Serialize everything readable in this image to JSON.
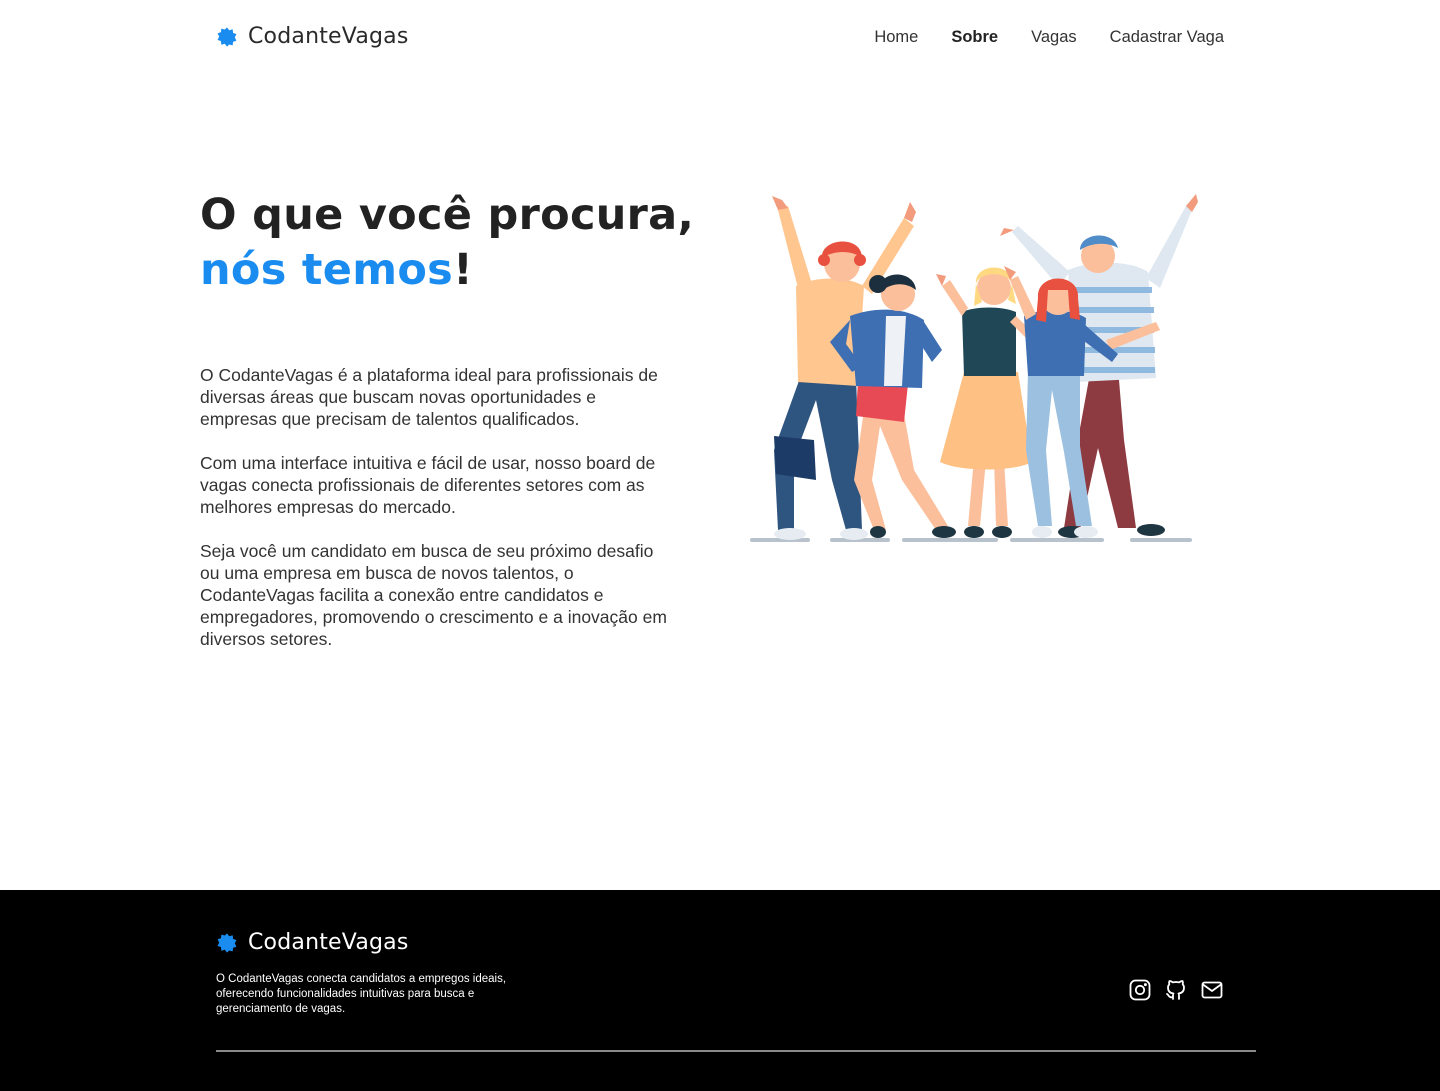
{
  "brand": {
    "name": "CodanteVagas",
    "icon": "star-badge-icon",
    "accent_color": "#1a8cf0"
  },
  "nav": {
    "items": [
      {
        "label": "Home",
        "active": false
      },
      {
        "label": "Sobre",
        "active": true
      },
      {
        "label": "Vagas",
        "active": false
      },
      {
        "label": "Cadastrar Vaga",
        "active": false
      }
    ]
  },
  "hero": {
    "title_line1": "O que você procura,",
    "title_accent": "nós temos",
    "title_end": "!",
    "paragraphs": [
      "O CodanteVagas é a plataforma ideal para profissionais de diversas áreas que buscam novas oportunidades e empresas que precisam de talentos qualificados.",
      "Com uma interface intuitiva e fácil de usar, nosso board de vagas conecta profissionais de diferentes setores com as melhores empresas do mercado.",
      "Seja você um candidato em busca de seu próximo desafio ou uma empresa em busca de novos talentos, o CodanteVagas facilita a conexão entre candidatos e empregadores, promovendo o crescimento e a inovação em diversos setores."
    ],
    "illustration": "group-of-people-celebrating-illustration"
  },
  "footer": {
    "brand_name": "CodanteVagas",
    "description": "O CodanteVagas conecta candidatos a empregos ideais, oferecendo funcionalidades intuitivas para busca e gerenciamento de vagas.",
    "socials": [
      "instagram-icon",
      "github-icon",
      "mail-icon"
    ],
    "background": "#000000"
  }
}
